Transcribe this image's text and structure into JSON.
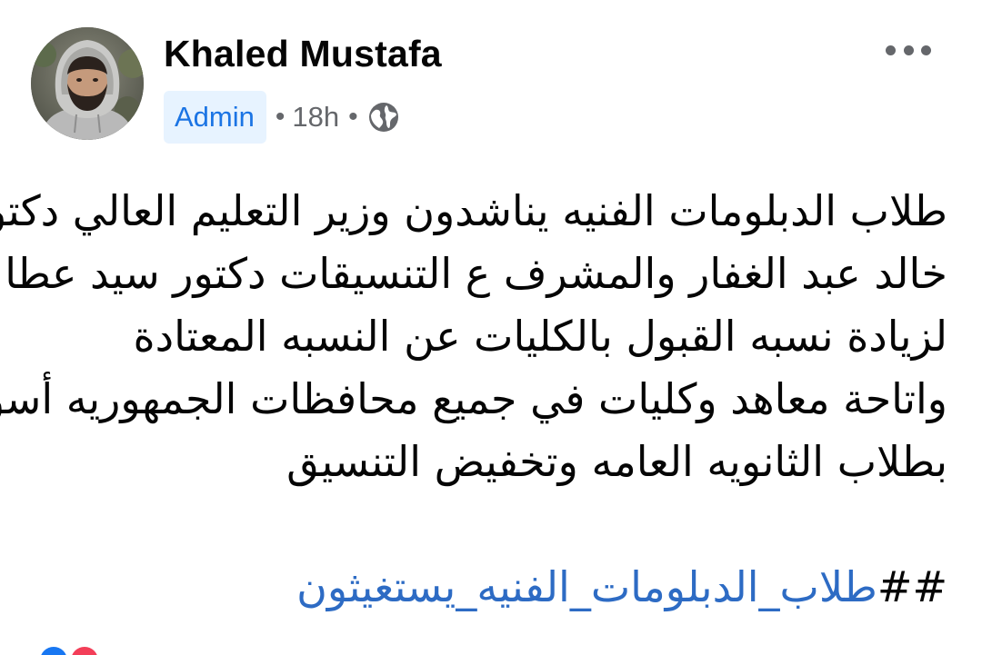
{
  "post": {
    "author": "Khaled Mustafa",
    "badge": "Admin",
    "separator": "•",
    "time": "18h",
    "body_lines": [
      "طلاب الدبلومات الفنيه يناشدون وزير التعليم العالي دكتور",
      "خالد عبد الغفار  والمشرف ع التنسيقات دكتور سيد عطا",
      "لزيادة نسبه القبول بالكليات عن النسبه المعتادة",
      "واتاحة معاهد وكليات في جميع محافظات الجمهوريه أسوة",
      "بطلاب الثانويه العامه وتخفيض التنسيق"
    ],
    "hashtag_prefix": "##",
    "hashtag_text": "طلاب_الدبلومات_الفنيه_يستغيثون"
  },
  "icons": {
    "avatar": "profile-photo",
    "privacy": "globe-icon",
    "more": "more-options-icon"
  },
  "colors": {
    "badge_bg": "#e7f3ff",
    "badge_text": "#1b74e4",
    "secondary_text": "#65676b",
    "hashtag": "#2d6bc4",
    "primary_text": "#050505"
  }
}
